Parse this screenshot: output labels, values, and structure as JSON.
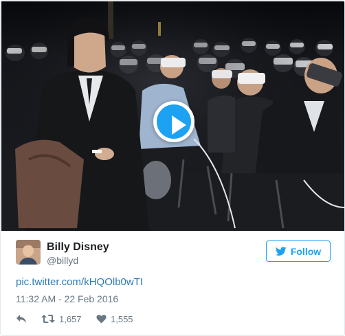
{
  "tweet": {
    "display_name": "Billy Disney",
    "screen_name": "@billyd",
    "follow_label": "Follow",
    "link_text": "pic.twitter.com/kHQOlb0wTI",
    "timestamp": "11:32 AM - 22 Feb 2016",
    "retweet_count": "1,657",
    "like_count": "1,555"
  },
  "media": {
    "type": "video",
    "play_icon": "play-icon"
  },
  "icons": {
    "follow": "bird-icon",
    "reply": "reply-icon",
    "retweet": "retweet-icon",
    "like": "heart-icon"
  },
  "colors": {
    "accent": "#1da1f2",
    "link": "#2b7bb9",
    "meta_text": "#697882",
    "border": "#e1e8ed"
  }
}
